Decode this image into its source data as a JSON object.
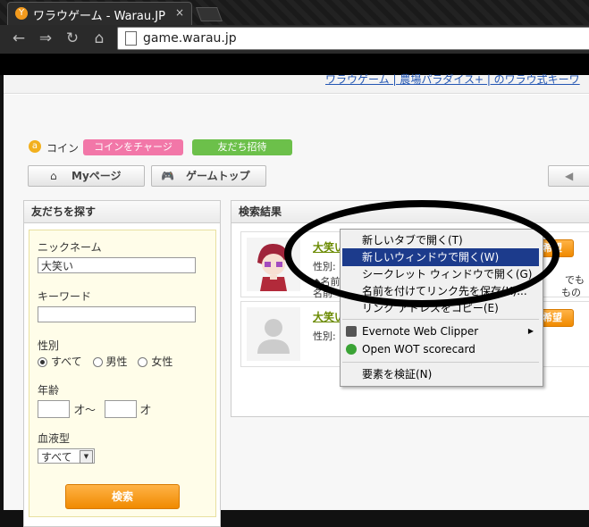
{
  "browser": {
    "tab_title": "ワラウゲーム - Warau.JP",
    "tab_close": "×",
    "url": "game.warau.jp",
    "back_glyph": "←",
    "forward_glyph": "⇒",
    "reload_glyph": "↻",
    "home_glyph": "⌂"
  },
  "page": {
    "banner_link": "ワラウゲーム | 農場パラダイス+ | のワラウ式キーワ",
    "coin_icon_letter": "a",
    "coin_label": "コイン",
    "charge_button": "コインをチャージ",
    "invite_button": "友だち招待",
    "mypage_tab": "Myページ",
    "gametop_tab": "ゲームトップ",
    "right_tab_fragment": "◀"
  },
  "search": {
    "title": "友だちを探す",
    "nickname_label": "ニックネーム",
    "nickname_value": "大笑い",
    "keyword_label": "キーワード",
    "keyword_value": "",
    "gender_label": "性別",
    "gender_options": [
      "すべて",
      "男性",
      "女性"
    ],
    "age_label": "年齢",
    "age_sep": "才〜",
    "age_suffix": "才",
    "blood_label": "血液型",
    "blood_value": "すべて",
    "submit": "検索"
  },
  "results": {
    "title": "検索結果",
    "items": [
      {
        "name": "大笑い",
        "detail": "性別:",
        "line2": "◆名前",
        "line3": "名前",
        "right1": "でも",
        "right2": "もの",
        "btn": "希望"
      },
      {
        "name": "大笑い",
        "detail": "性別:",
        "btn": "希望"
      }
    ]
  },
  "context_menu": {
    "items": [
      "新しいタブで開く(T)",
      "新しいウィンドウで開く(W)",
      "シークレット ウィンドウで開く(G)",
      "名前を付けてリンク先を保存(K)...",
      "リンク アドレスをコピー(E)",
      "Evernote Web Clipper",
      "Open WOT scorecard",
      "要素を検証(N)"
    ],
    "submenu_arrow": "▶"
  }
}
